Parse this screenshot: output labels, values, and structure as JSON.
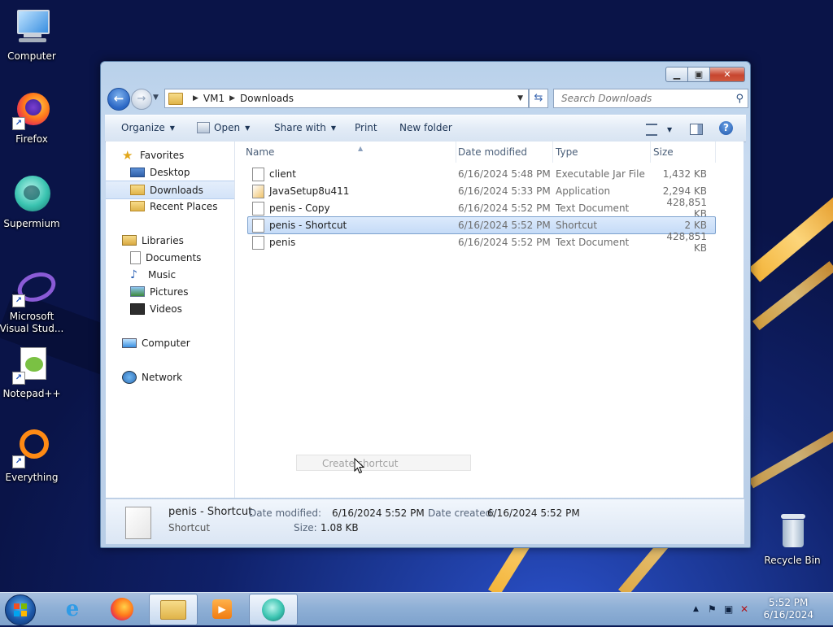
{
  "desktop": {
    "icons": [
      {
        "label": "Computer"
      },
      {
        "label": "Firefox"
      },
      {
        "label": "Supermium"
      },
      {
        "label": "Microsoft Visual Stud..."
      },
      {
        "label": "Notepad++"
      },
      {
        "label": "Everything"
      },
      {
        "label": "Recycle Bin"
      }
    ]
  },
  "window": {
    "breadcrumb": [
      "VM1",
      "Downloads"
    ],
    "search_placeholder": "Search Downloads",
    "toolbar": {
      "organize": "Organize",
      "open": "Open",
      "share_with": "Share with",
      "print": "Print",
      "new_folder": "New folder"
    },
    "nav": {
      "favorites": "Favorites",
      "desktop": "Desktop",
      "downloads": "Downloads",
      "recent_places": "Recent Places",
      "libraries": "Libraries",
      "documents": "Documents",
      "music": "Music",
      "pictures": "Pictures",
      "videos": "Videos",
      "computer": "Computer",
      "network": "Network"
    },
    "columns": {
      "name": "Name",
      "date": "Date modified",
      "type": "Type",
      "size": "Size"
    },
    "files": [
      {
        "name": "client",
        "date": "6/16/2024 5:48 PM",
        "type": "Executable Jar File",
        "size": "1,432 KB"
      },
      {
        "name": "JavaSetup8u411",
        "date": "6/16/2024 5:33 PM",
        "type": "Application",
        "size": "2,294 KB"
      },
      {
        "name": "penis - Copy",
        "date": "6/16/2024 5:52 PM",
        "type": "Text Document",
        "size": "428,851 KB"
      },
      {
        "name": "penis - Shortcut",
        "date": "6/16/2024 5:52 PM",
        "type": "Shortcut",
        "size": "2 KB"
      },
      {
        "name": "penis",
        "date": "6/16/2024 5:52 PM",
        "type": "Text Document",
        "size": "428,851 KB"
      }
    ],
    "drag_tip": "Create shortcut",
    "details": {
      "name": "penis - Shortcut",
      "type": "Shortcut",
      "date_modified_label": "Date modified:",
      "date_modified": "6/16/2024 5:52 PM",
      "date_created_label": "Date created:",
      "date_created": "6/16/2024 5:52 PM",
      "size_label": "Size:",
      "size": "1.08 KB"
    }
  },
  "taskbar": {
    "time": "5:52 PM",
    "date": "6/16/2024"
  },
  "colors": {
    "selection": "#cce0f8",
    "accent": "#1d58a8"
  }
}
